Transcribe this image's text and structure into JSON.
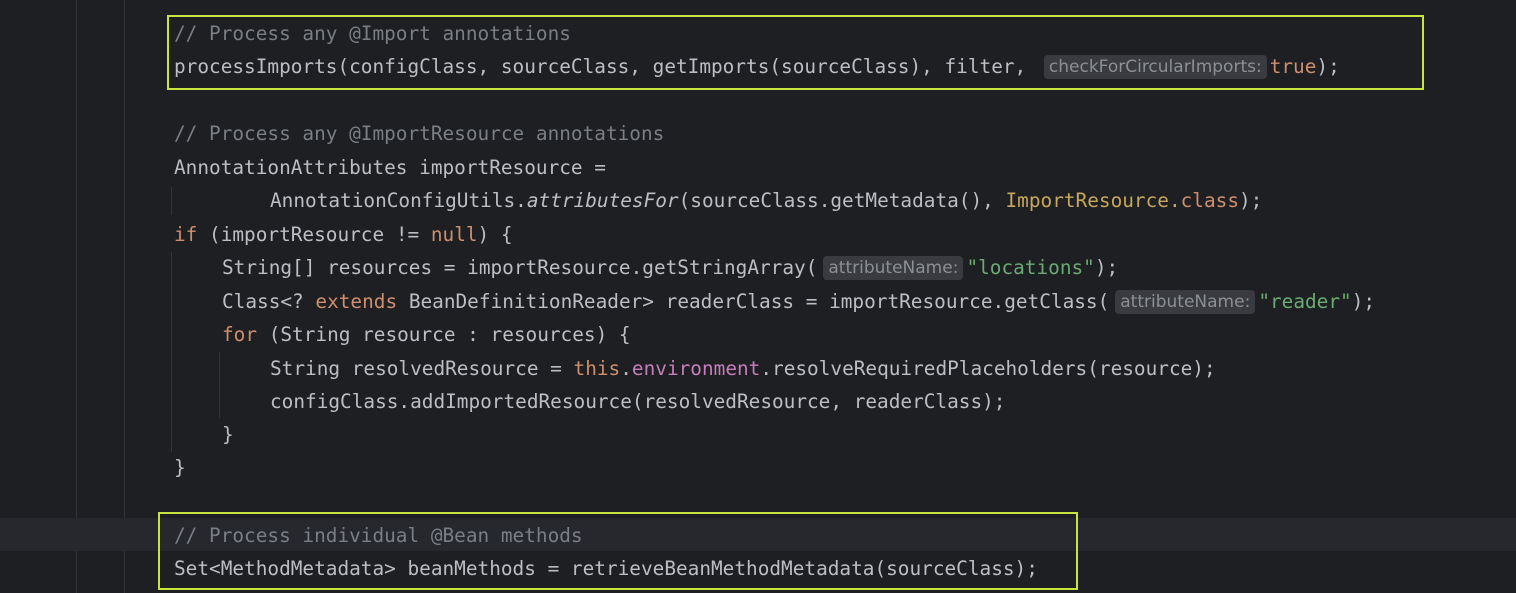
{
  "editor": {
    "colors": {
      "background": "#1e1f22",
      "plain": "#bcbec4",
      "comment": "#7a7e85",
      "keyword": "#cf8e6d",
      "string": "#6aab73",
      "class_ref": "#c7a65d",
      "field": "#c77dbb",
      "inlay_hint_bg": "#393b40",
      "highlight_border": "#c6e63f"
    },
    "lines": [
      [
        {
          "t": "// Process any @Import annotations",
          "k": "comment"
        }
      ],
      [
        {
          "t": "processImports(configClass, sourceClass, getImports(sourceClass), filter, ",
          "k": "plain"
        },
        {
          "t": "checkForCircularImports:",
          "k": "hint"
        },
        {
          "t": "true",
          "k": "kw"
        },
        {
          "t": ");",
          "k": "plain"
        }
      ],
      [],
      [
        {
          "t": "// Process any @ImportResource annotations",
          "k": "comment"
        }
      ],
      [
        {
          "t": "AnnotationAttributes importResource =",
          "k": "plain"
        }
      ],
      [
        {
          "t": "AnnotationConfigUtils.",
          "k": "plain"
        },
        {
          "t": "attributesFor",
          "k": "static"
        },
        {
          "t": "(sourceClass.getMetadata(), ",
          "k": "plain"
        },
        {
          "t": "ImportResource.",
          "k": "cls"
        },
        {
          "t": "class",
          "k": "kw"
        },
        {
          "t": ");",
          "k": "plain"
        }
      ],
      [
        {
          "t": "if",
          "k": "kw"
        },
        {
          "t": " (importResource != ",
          "k": "plain"
        },
        {
          "t": "null",
          "k": "kw"
        },
        {
          "t": ") {",
          "k": "plain"
        }
      ],
      [
        {
          "t": "String[] resources = importResource.getStringArray(",
          "k": "plain"
        },
        {
          "t": "attributeName:",
          "k": "hint"
        },
        {
          "t": "\"locations\"",
          "k": "str"
        },
        {
          "t": ");",
          "k": "plain"
        }
      ],
      [
        {
          "t": "Class<? ",
          "k": "plain"
        },
        {
          "t": "extends",
          "k": "kw"
        },
        {
          "t": " BeanDefinitionReader> readerClass = importResource.getClass(",
          "k": "plain"
        },
        {
          "t": "attributeName:",
          "k": "hint"
        },
        {
          "t": "\"reader\"",
          "k": "str"
        },
        {
          "t": ");",
          "k": "plain"
        }
      ],
      [
        {
          "t": "for",
          "k": "kw"
        },
        {
          "t": " (String resource : resources) {",
          "k": "plain"
        }
      ],
      [
        {
          "t": "String resolvedResource = ",
          "k": "plain"
        },
        {
          "t": "this",
          "k": "kw"
        },
        {
          "t": ".",
          "k": "plain"
        },
        {
          "t": "environment",
          "k": "field"
        },
        {
          "t": ".resolveRequiredPlaceholders(resource);",
          "k": "plain"
        }
      ],
      [
        {
          "t": "configClass.addImportedResource(resolvedResource, readerClass);",
          "k": "plain"
        }
      ],
      [
        {
          "t": "}",
          "k": "plain"
        }
      ],
      [
        {
          "t": "}",
          "k": "plain"
        }
      ],
      [],
      [
        {
          "t": "// Process individual @Bean methods",
          "k": "comment"
        }
      ],
      [
        {
          "t": "Set<MethodMetadata> beanMethods = retrieveBeanMethodMetadata(sourceClass);",
          "k": "plain"
        }
      ]
    ]
  }
}
